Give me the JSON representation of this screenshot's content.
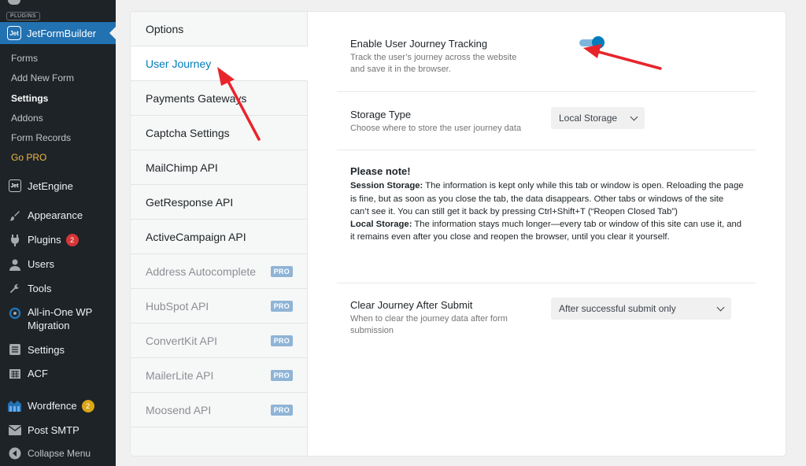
{
  "sidebar": {
    "tag": "PLUGINS",
    "active_plugin": "JetFormBuilder",
    "jet_logo_text": "Jet",
    "submenu": [
      "Forms",
      "Add New Form",
      "Settings",
      "Addons",
      "Form Records",
      "Go PRO"
    ],
    "menu": {
      "jetengine": "JetEngine",
      "appearance": "Appearance",
      "plugins": "Plugins",
      "plugins_badge": "2",
      "users": "Users",
      "tools": "Tools",
      "migration": "All-in-One WP Migration",
      "settings": "Settings",
      "acf": "ACF",
      "wordfence": "Wordfence",
      "wordfence_badge": "2",
      "post_smtp": "Post SMTP",
      "collapse": "Collapse Menu"
    }
  },
  "tabs": {
    "options": "Options",
    "user_journey": "User Journey",
    "payments": "Payments Gateways",
    "captcha": "Captcha Settings",
    "mailchimp": "MailChimp API",
    "getresponse": "GetResponse API",
    "activecampaign": "ActiveCampaign API",
    "address": "Address Autocomplete",
    "hubspot": "HubSpot API",
    "convertkit": "ConvertKit API",
    "mailerlite": "MailerLite API",
    "moosend": "Moosend API",
    "pro_label": "PRO"
  },
  "panel": {
    "tracking": {
      "title": "Enable User Journey Tracking",
      "desc_line1": "Track the user’s journey across the website",
      "desc_line2": "and save it in the browser.",
      "enabled": true
    },
    "storage": {
      "title": "Storage Type",
      "desc": "Choose where to store the user journey data",
      "value": "Local Storage"
    },
    "note": {
      "title": "Please note!",
      "session_label": "Session Storage:",
      "session_text": " The information is kept only while this tab or window is open. Reloading the page is fine, but as soon as you close the tab, the data disappears. Other tabs or windows of the site can’t see it. You can still get it back by pressing Ctrl+Shift+T (“Reopen Closed Tab”)",
      "local_label": "Local Storage:",
      "local_text": " The information stays much longer—every tab or window of this site can use it, and it remains even after you close and reopen the browser, until you clear it yourself."
    },
    "clear": {
      "title": "Clear Journey After Submit",
      "desc_line1": "When to clear the journey data after form",
      "desc_line2": "submission",
      "value": "After successful submit only"
    }
  },
  "colors": {
    "admin_bar_bg": "#1d2327",
    "admin_accent": "#2271b1",
    "tab_active": "#007cba",
    "toggle_on": "#007cba",
    "arrow": "#e8242b"
  }
}
